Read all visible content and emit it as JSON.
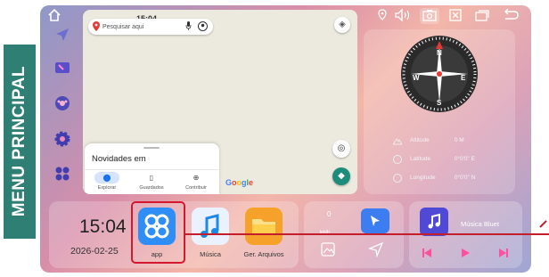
{
  "side_banner": {
    "label": "MENU PRINCIPAL"
  },
  "statusbar": {
    "icons": [
      "home-icon",
      "location-pin-icon",
      "volume-icon",
      "screenshot-icon",
      "close-window-icon",
      "multitask-icon",
      "back-icon"
    ]
  },
  "dock": {
    "items": [
      "navigation-icon",
      "video-icon",
      "steering-wheel-icon",
      "settings-icon",
      "apps-icon"
    ]
  },
  "map": {
    "time": "15:04",
    "search_placeholder": "Pesquisar aqui",
    "sheet_title": "Novidades em",
    "tabs": [
      {
        "label": "Explorar",
        "icon": "pin-icon",
        "active": true
      },
      {
        "label": "Guardados",
        "icon": "bookmark-icon",
        "active": false
      },
      {
        "label": "Contribuir",
        "icon": "add-circle-icon",
        "active": false
      }
    ],
    "google_logo": "Google"
  },
  "compass": {
    "directions": {
      "n": "N",
      "s": "S",
      "e": "E",
      "w": "W"
    },
    "rows": [
      {
        "key": "Altitude",
        "value": "0 M"
      },
      {
        "key": "Latitude",
        "value": "0°0'0\" E"
      },
      {
        "key": "Longitude",
        "value": "0°0'0\" N"
      }
    ]
  },
  "clock": {
    "time": "15:04",
    "date": "2026-02-25"
  },
  "apps": [
    {
      "label": "app",
      "icon": "app-grid-icon",
      "color": "#2f8ef6"
    },
    {
      "label": "Música",
      "icon": "music-note-icon",
      "color": "#eaf2ff"
    },
    {
      "label": "Ger. Arquivos",
      "icon": "folder-icon",
      "color": "#f6a22a"
    }
  ],
  "nav_widget": {
    "zero": "0",
    "small_label": "km/h"
  },
  "music_widget": {
    "label": "Música Bluet",
    "accent": "#ff4f9e"
  },
  "colors": {
    "highlight": "#d3182d",
    "banner": "#2f7f74",
    "nav_button": "#1e8c7a"
  }
}
